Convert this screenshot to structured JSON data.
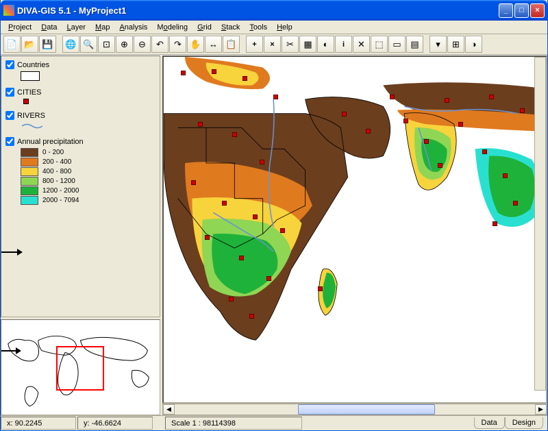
{
  "title": "DIVA-GIS 5.1 - MyProject1",
  "menu": {
    "project": "Project",
    "data": "Data",
    "layer": "Layer",
    "map": "Map",
    "analysis": "Analysis",
    "modeling": "Modeling",
    "grid": "Grid",
    "stack": "Stack",
    "tools": "Tools",
    "help": "Help"
  },
  "layers": {
    "countries": {
      "label": "Countries",
      "checked": true
    },
    "cities": {
      "label": "CITIES",
      "checked": true
    },
    "rivers": {
      "label": "RIVERS",
      "checked": true
    },
    "precip": {
      "label": "Annual precipitation",
      "checked": true,
      "classes": [
        {
          "color": "#6b3e1e",
          "label": "0 - 200"
        },
        {
          "color": "#e07a1f",
          "label": "200 - 400"
        },
        {
          "color": "#f7d33c",
          "label": "400 - 800"
        },
        {
          "color": "#8fd654",
          "label": "800 - 1200"
        },
        {
          "color": "#1fb23a",
          "label": "1200 - 2000"
        },
        {
          "color": "#29e0d0",
          "label": "2000 - 7094"
        }
      ]
    }
  },
  "status": {
    "x": "x: 90.2245",
    "y": "y: -46.6624",
    "scale": "Scale 1 : 98114398"
  },
  "tabs": {
    "data": "Data",
    "design": "Design"
  },
  "toolbar_icons": [
    "new-icon",
    "open-icon",
    "save-icon",
    "globe-icon",
    "zoom-globe-icon",
    "zoom-full-icon",
    "zoom-in-icon",
    "zoom-out-icon",
    "undo-icon",
    "redo-icon",
    "pan-icon",
    "measure-icon",
    "identify-icon",
    "add-icon",
    "remove-icon",
    "crop-icon",
    "table-icon",
    "chart-icon",
    "info-icon",
    "settings-icon",
    "select-icon",
    "selection-icon",
    "layers-icon",
    "options-icon",
    "analysis-icon"
  ]
}
